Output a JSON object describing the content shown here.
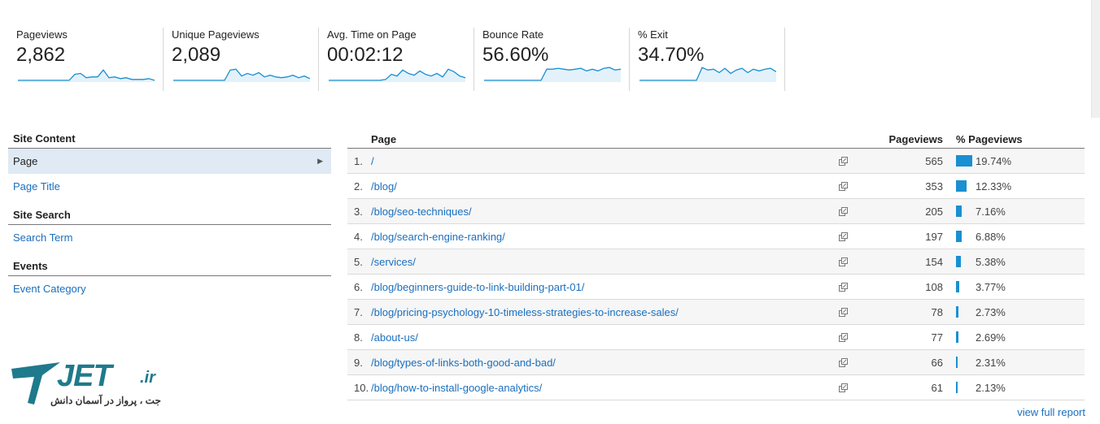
{
  "metrics": [
    {
      "label": "Pageviews",
      "value": "2,862",
      "spark": [
        2,
        2,
        2,
        2,
        2,
        2,
        2,
        2,
        2,
        2,
        9,
        10,
        5,
        6,
        6,
        14,
        5,
        6,
        4,
        5,
        3,
        3,
        3,
        4,
        2
      ],
      "color": "#1a8fd1"
    },
    {
      "label": "Unique Pageviews",
      "value": "2,089",
      "spark": [
        2,
        2,
        2,
        2,
        2,
        2,
        2,
        2,
        2,
        2,
        14,
        15,
        7,
        10,
        8,
        11,
        6,
        8,
        6,
        5,
        6,
        8,
        5,
        7,
        4
      ],
      "color": "#1a8fd1"
    },
    {
      "label": "Avg. Time on Page",
      "value": "00:02:12",
      "spark": [
        2,
        2,
        2,
        2,
        2,
        2,
        2,
        2,
        2,
        2,
        3,
        9,
        7,
        14,
        10,
        8,
        13,
        9,
        7,
        10,
        6,
        15,
        12,
        7,
        5
      ],
      "color": "#1a8fd1"
    },
    {
      "label": "Bounce Rate",
      "value": "56.60%",
      "spark": [
        2,
        2,
        2,
        2,
        2,
        2,
        2,
        2,
        2,
        2,
        2,
        15,
        15,
        16,
        15,
        14,
        15,
        16,
        13,
        15,
        13,
        16,
        17,
        14,
        15
      ],
      "color": "#1a8fd1"
    },
    {
      "label": "% Exit",
      "value": "34.70%",
      "spark": [
        2,
        2,
        2,
        2,
        2,
        2,
        2,
        2,
        2,
        2,
        2,
        17,
        14,
        15,
        11,
        16,
        10,
        14,
        16,
        11,
        15,
        13,
        15,
        16,
        12
      ],
      "color": "#1a8fd1"
    }
  ],
  "sidebar": {
    "sections": [
      {
        "heading": "Site Content",
        "items": [
          {
            "label": "Page",
            "active": true
          },
          {
            "label": "Page Title",
            "active": false
          }
        ]
      },
      {
        "heading": "Site Search",
        "items": [
          {
            "label": "Search Term",
            "active": false
          }
        ]
      },
      {
        "heading": "Events",
        "items": [
          {
            "label": "Event Category",
            "active": false
          }
        ]
      }
    ]
  },
  "table": {
    "headers": {
      "page": "Page",
      "pageviews": "Pageviews",
      "pct": "% Pageviews"
    },
    "rows": [
      {
        "rank": "1.",
        "url": "/",
        "pageviews": "565",
        "pct": "19.74%",
        "share": 19.74
      },
      {
        "rank": "2.",
        "url": "/blog/",
        "pageviews": "353",
        "pct": "12.33%",
        "share": 12.33
      },
      {
        "rank": "3.",
        "url": "/blog/seo-techniques/",
        "pageviews": "205",
        "pct": "7.16%",
        "share": 7.16
      },
      {
        "rank": "4.",
        "url": "/blog/search-engine-ranking/",
        "pageviews": "197",
        "pct": "6.88%",
        "share": 6.88
      },
      {
        "rank": "5.",
        "url": "/services/",
        "pageviews": "154",
        "pct": "5.38%",
        "share": 5.38
      },
      {
        "rank": "6.",
        "url": "/blog/beginners-guide-to-link-building-part-01/",
        "pageviews": "108",
        "pct": "3.77%",
        "share": 3.77
      },
      {
        "rank": "7.",
        "url": "/blog/pricing-psychology-10-timeless-strategies-to-increase-sales/",
        "pageviews": "78",
        "pct": "2.73%",
        "share": 2.73
      },
      {
        "rank": "8.",
        "url": "/about-us/",
        "pageviews": "77",
        "pct": "2.69%",
        "share": 2.69
      },
      {
        "rank": "9.",
        "url": "/blog/types-of-links-both-good-and-bad/",
        "pageviews": "66",
        "pct": "2.31%",
        "share": 2.31
      },
      {
        "rank": "10.",
        "url": "/blog/how-to-install-google-analytics/",
        "pageviews": "61",
        "pct": "2.13%",
        "share": 2.13
      }
    ],
    "view_full_report": "view full report"
  },
  "logo": {
    "brand": "JET",
    "tld": ".ir",
    "tagline": "جت ، پرواز در آسمان دانش",
    "color": "#1f7a8c"
  }
}
